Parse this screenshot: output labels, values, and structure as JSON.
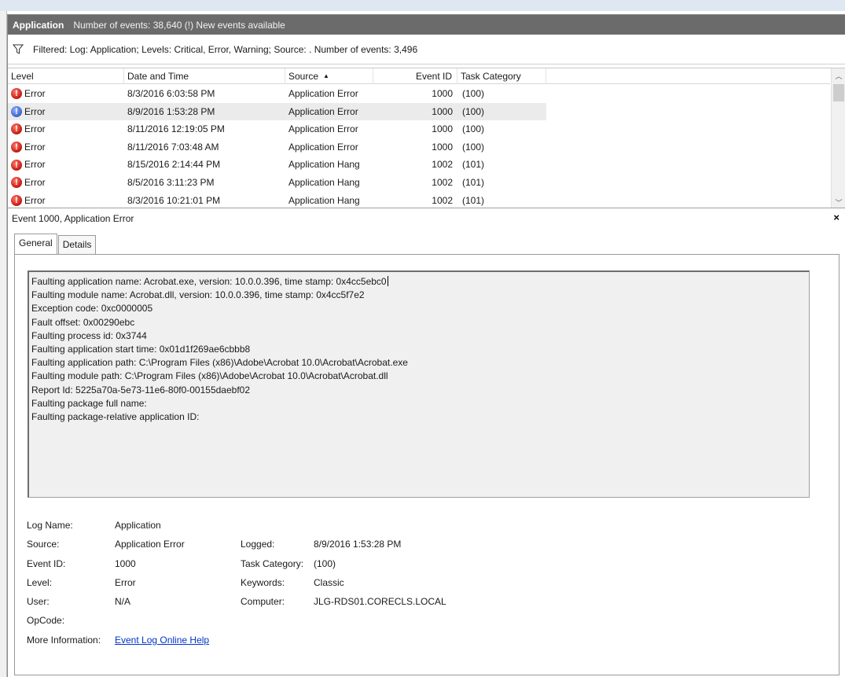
{
  "panel": {
    "name": "Application",
    "info": "Number of events: 38,640 (!) New events available"
  },
  "filter": {
    "icon": "filter-icon",
    "text": "Filtered: Log: Application; Levels: Critical, Error, Warning; Source: . Number of events: 3,496"
  },
  "grid": {
    "columns": {
      "level": "Level",
      "date": "Date and Time",
      "source": "Source",
      "event_id": "Event ID",
      "category": "Task Category"
    },
    "rows": [
      {
        "level": "Error",
        "date": "8/3/2016 6:03:58 PM",
        "source": "Application Error",
        "event_id": "1000",
        "category": "(100)"
      },
      {
        "level": "Error",
        "date": "8/9/2016 1:53:28 PM",
        "source": "Application Error",
        "event_id": "1000",
        "category": "(100)"
      },
      {
        "level": "Error",
        "date": "8/11/2016 12:19:05 PM",
        "source": "Application Error",
        "event_id": "1000",
        "category": "(100)"
      },
      {
        "level": "Error",
        "date": "8/11/2016 7:03:48 AM",
        "source": "Application Error",
        "event_id": "1000",
        "category": "(100)"
      },
      {
        "level": "Error",
        "date": "8/15/2016 2:14:44 PM",
        "source": "Application Hang",
        "event_id": "1002",
        "category": "(101)"
      },
      {
        "level": "Error",
        "date": "8/5/2016 3:11:23 PM",
        "source": "Application Hang",
        "event_id": "1002",
        "category": "(101)"
      },
      {
        "level": "Error",
        "date": "8/3/2016 10:21:01 PM",
        "source": "Application Hang",
        "event_id": "1002",
        "category": "(101)"
      }
    ]
  },
  "detail": {
    "title": "Event 1000, Application Error",
    "close": "×",
    "tabs": {
      "general": "General",
      "details": "Details"
    },
    "description": [
      "Faulting application name: Acrobat.exe, version: 10.0.0.396, time stamp: 0x4cc5ebc0",
      "Faulting module name: Acrobat.dll, version: 10.0.0.396, time stamp: 0x4cc5f7e2",
      "Exception code: 0xc0000005",
      "Fault offset: 0x00290ebc",
      "Faulting process id: 0x3744",
      "Faulting application start time: 0x01d1f269ae6cbbb8",
      "Faulting application path: C:\\Program Files (x86)\\Adobe\\Acrobat 10.0\\Acrobat\\Acrobat.exe",
      "Faulting module path: C:\\Program Files (x86)\\Adobe\\Acrobat 10.0\\Acrobat\\Acrobat.dll",
      "Report Id: 5225a70a-5e73-11e6-80f0-00155daebf02",
      "Faulting package full name:",
      "Faulting package-relative application ID:"
    ],
    "props": {
      "log_name_label": "Log Name:",
      "log_name": "Application",
      "source_label": "Source:",
      "source": "Application Error",
      "logged_label": "Logged:",
      "logged": "8/9/2016 1:53:28 PM",
      "event_id_label": "Event ID:",
      "event_id": "1000",
      "task_category_label": "Task Category:",
      "task_category": "(100)",
      "level_label": "Level:",
      "level": "Error",
      "keywords_label": "Keywords:",
      "keywords": "Classic",
      "user_label": "User:",
      "user": "N/A",
      "computer_label": "Computer:",
      "computer": "JLG-RDS01.CORECLS.LOCAL",
      "opcode_label": "OpCode:",
      "opcode": "",
      "more_info_label": "More Information:",
      "more_info_link": "Event Log Online Help"
    }
  }
}
